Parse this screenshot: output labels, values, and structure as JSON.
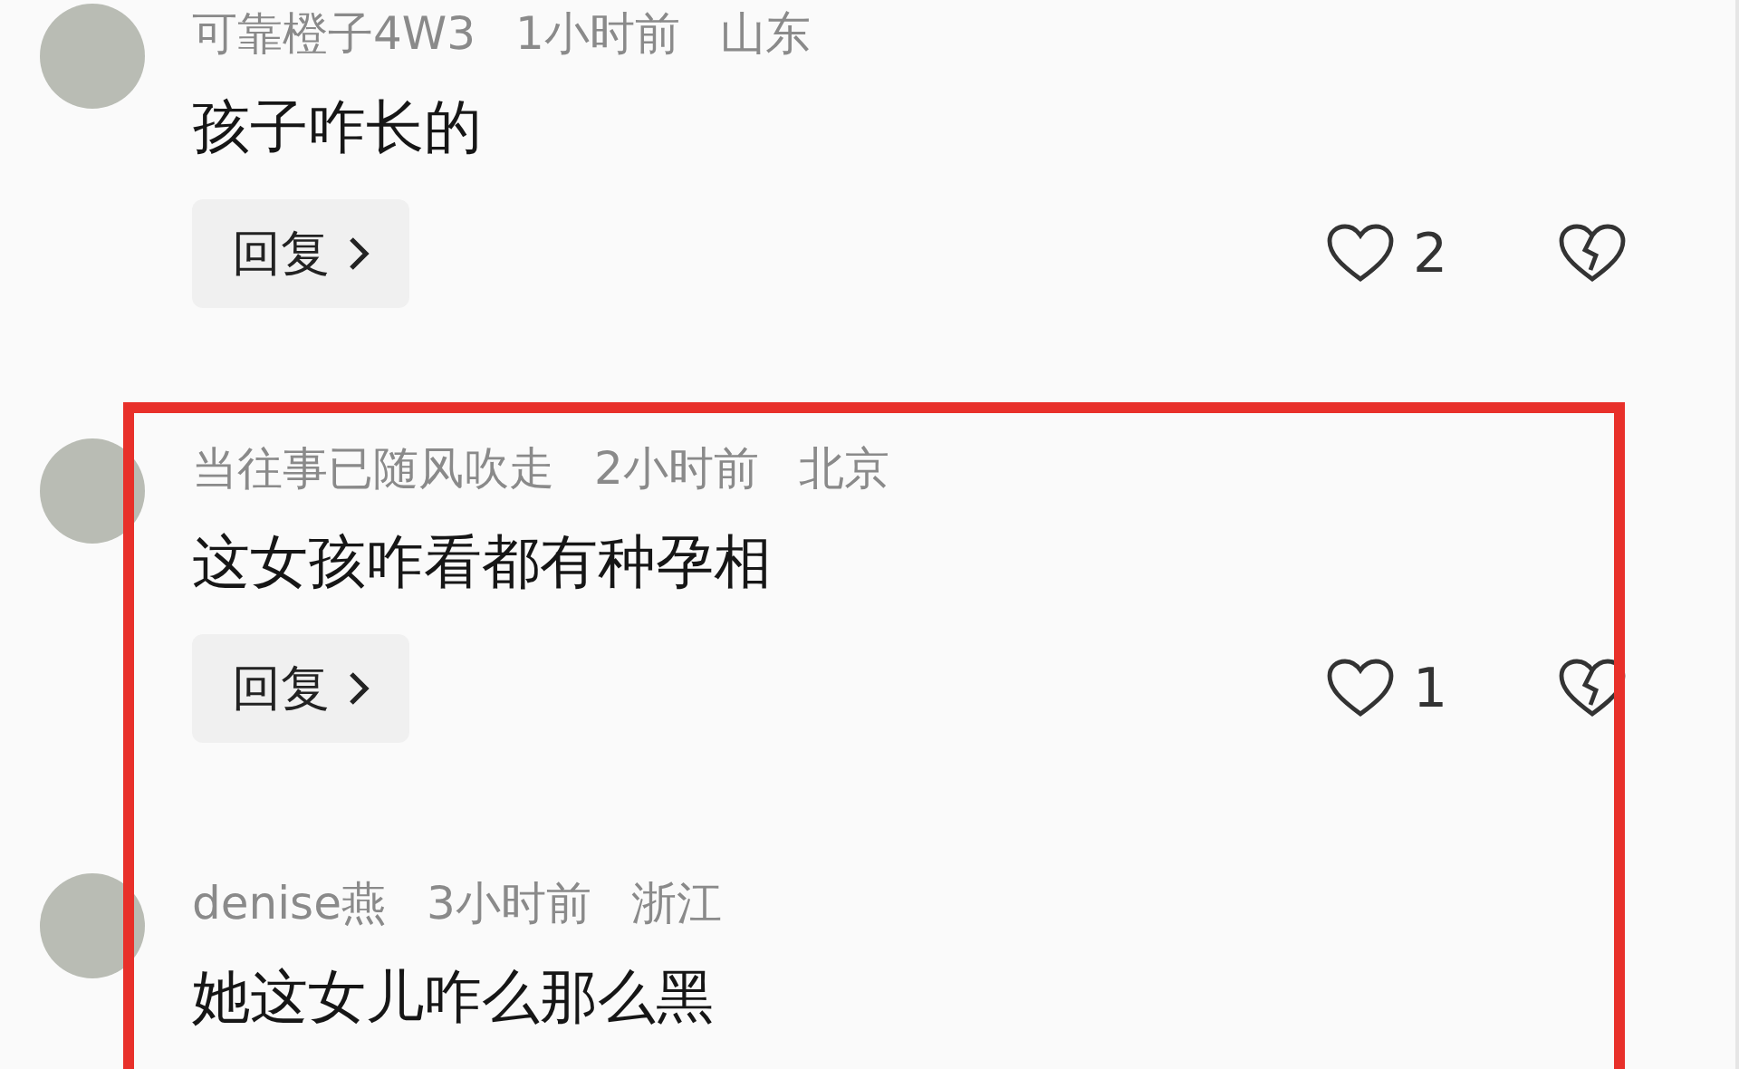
{
  "comments": [
    {
      "username": "可靠橙子4W3",
      "time": "1小时前",
      "location": "山东",
      "text": "孩子咋长的",
      "reply_label": "回复",
      "likes": "2"
    },
    {
      "username": "当往事已随风吹走",
      "time": "2小时前",
      "location": "北京",
      "text": "这女孩咋看都有种孕相",
      "reply_label": "回复",
      "likes": "1"
    },
    {
      "username": "denise燕",
      "time": "3小时前",
      "location": "浙江",
      "text": "她这女儿咋么那么黑"
    }
  ]
}
